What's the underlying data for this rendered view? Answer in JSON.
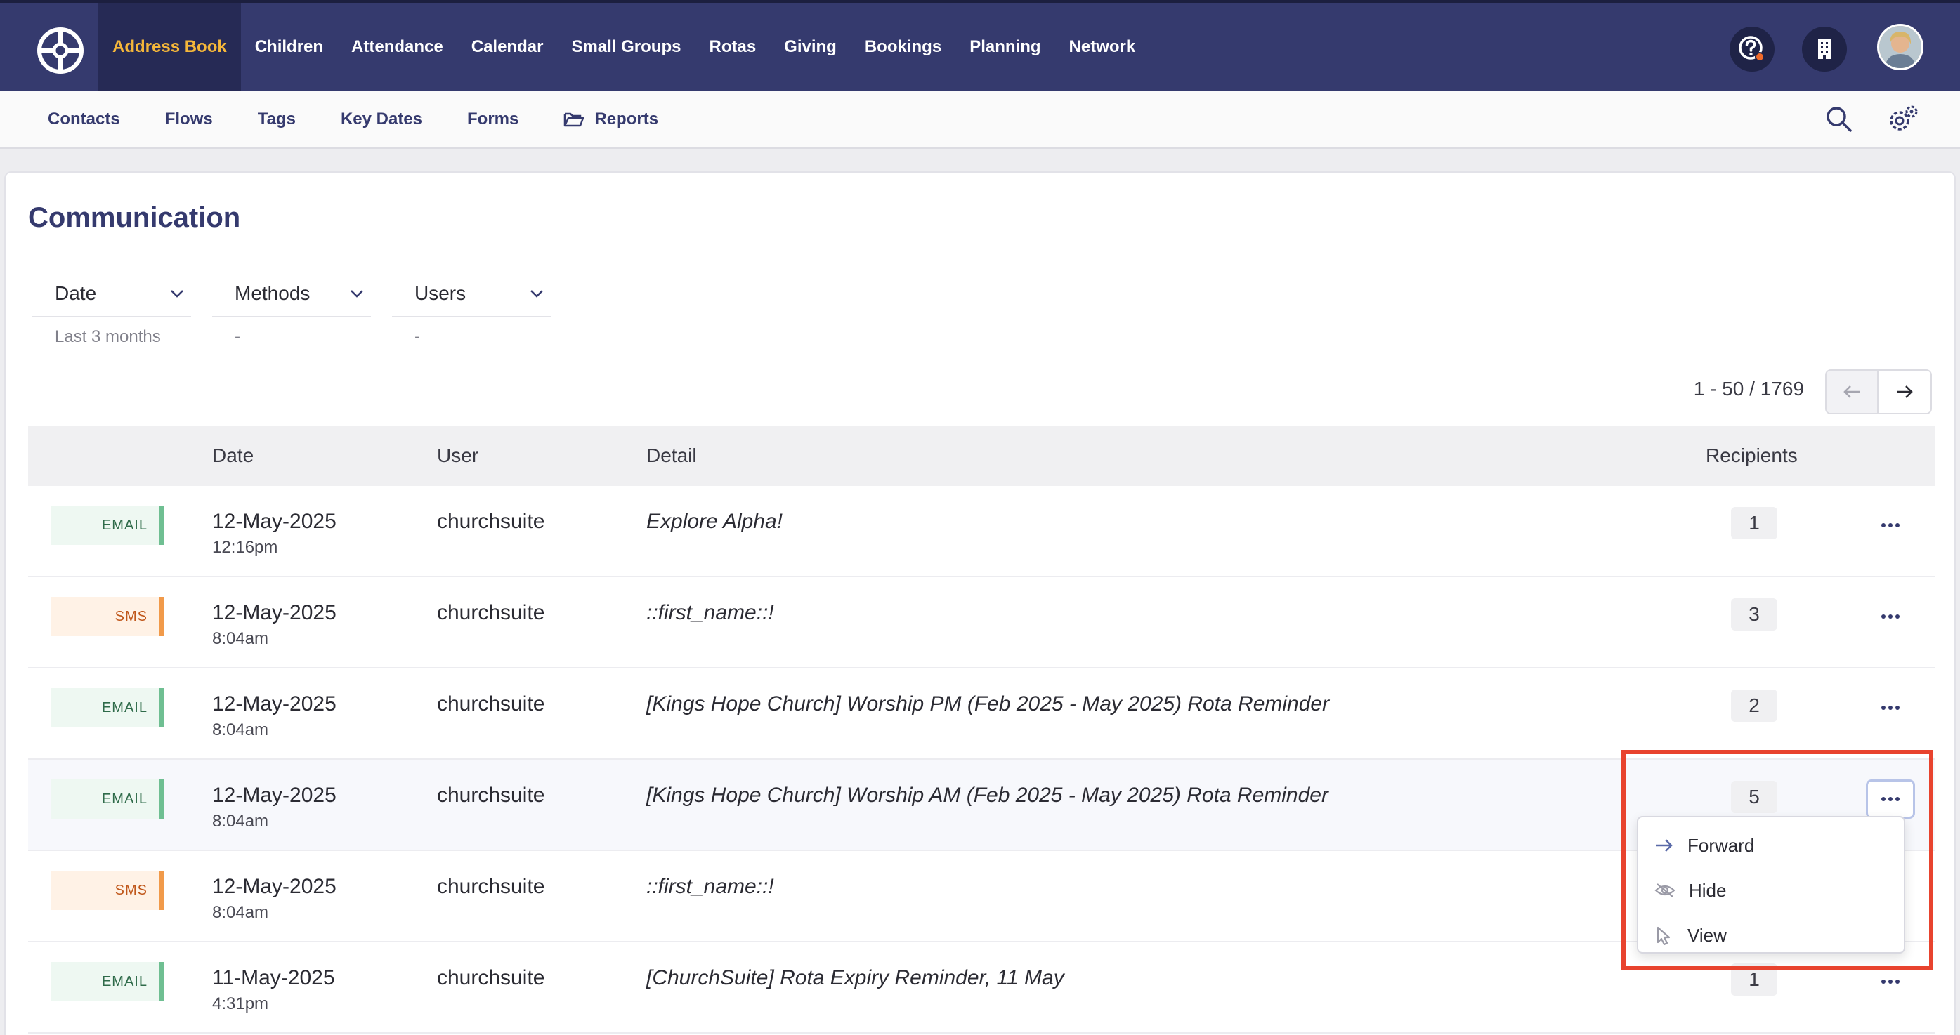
{
  "topnav": {
    "items": [
      "Address Book",
      "Children",
      "Attendance",
      "Calendar",
      "Small Groups",
      "Rotas",
      "Giving",
      "Bookings",
      "Planning",
      "Network"
    ],
    "active_index": 0
  },
  "subnav": {
    "items": [
      "Contacts",
      "Flows",
      "Tags",
      "Key Dates",
      "Forms",
      "Reports"
    ]
  },
  "page": {
    "title": "Communication"
  },
  "filters": [
    {
      "label": "Date",
      "value": "Last 3 months"
    },
    {
      "label": "Methods",
      "value": "-"
    },
    {
      "label": "Users",
      "value": "-"
    }
  ],
  "pagination": {
    "text": "1 - 50 / 1769"
  },
  "table": {
    "headers": {
      "date": "Date",
      "user": "User",
      "detail": "Detail",
      "recipients": "Recipients"
    },
    "rows": [
      {
        "method": "EMAIL",
        "date": "12-May-2025",
        "time": "12:16pm",
        "user": "churchsuite",
        "detail": "Explore Alpha!",
        "recipients": "1"
      },
      {
        "method": "SMS",
        "date": "12-May-2025",
        "time": "8:04am",
        "user": "churchsuite",
        "detail": "::first_name::!",
        "recipients": "3"
      },
      {
        "method": "EMAIL",
        "date": "12-May-2025",
        "time": "8:04am",
        "user": "churchsuite",
        "detail": "[Kings Hope Church] Worship PM (Feb 2025 - May 2025) Rota Reminder",
        "recipients": "2"
      },
      {
        "method": "EMAIL",
        "date": "12-May-2025",
        "time": "8:04am",
        "user": "churchsuite",
        "detail": "[Kings Hope Church] Worship AM (Feb 2025 - May 2025) Rota Reminder",
        "recipients": "5"
      },
      {
        "method": "SMS",
        "date": "12-May-2025",
        "time": "8:04am",
        "user": "churchsuite",
        "detail": "::first_name::!",
        "recipients": ""
      },
      {
        "method": "EMAIL",
        "date": "11-May-2025",
        "time": "4:31pm",
        "user": "churchsuite",
        "detail": "[ChurchSuite] Rota Expiry Reminder, 11 May",
        "recipients": "1"
      }
    ]
  },
  "menu": {
    "items": [
      {
        "label": "Forward",
        "icon": "arrow-right-icon"
      },
      {
        "label": "Hide",
        "icon": "eye-slash-icon"
      },
      {
        "label": "View",
        "icon": "pointer-icon"
      }
    ]
  },
  "colors": {
    "nav_bg": "#353a6e",
    "nav_active": "#f5b73a",
    "email_accent": "#6fbf92",
    "sms_accent": "#f19a4a",
    "highlight": "#e8432e"
  }
}
